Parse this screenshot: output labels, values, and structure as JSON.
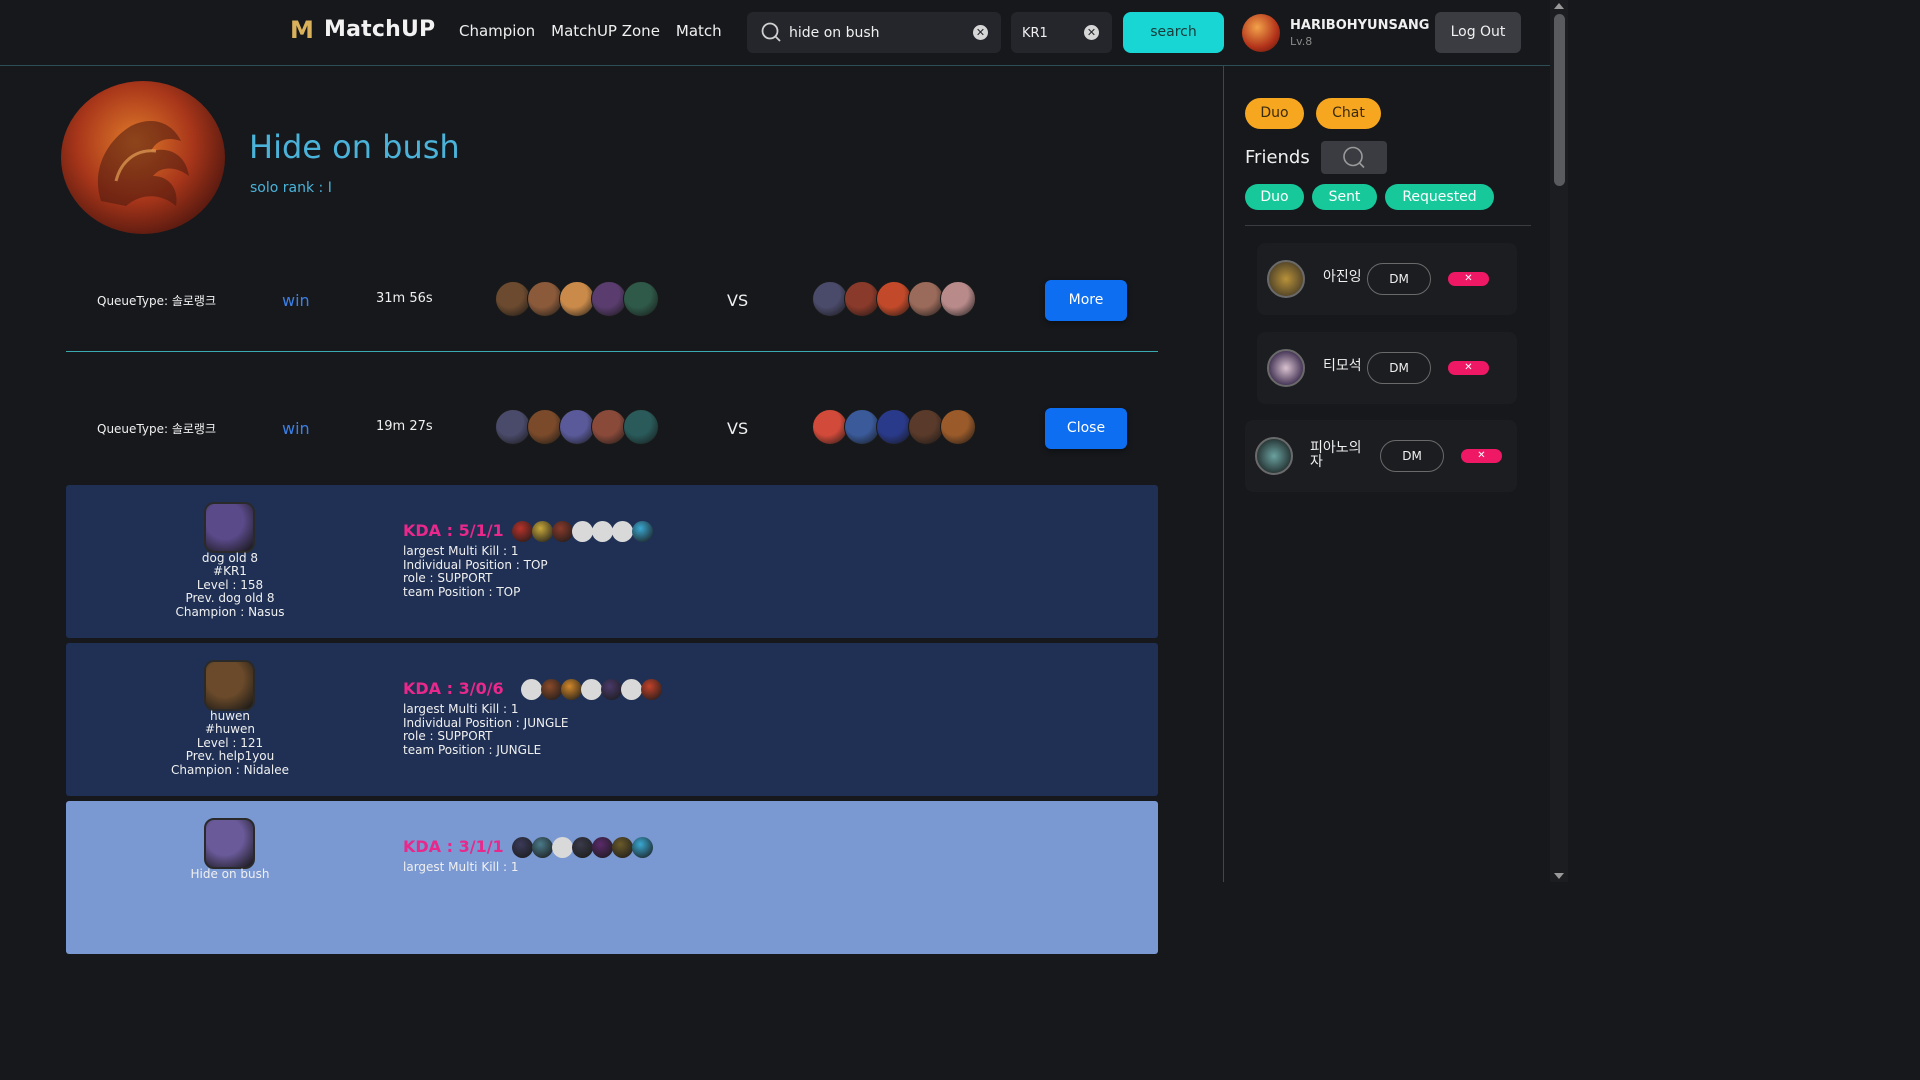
{
  "header": {
    "logo_mark": "M",
    "logo_text": "MatchUP",
    "nav": [
      "Champion",
      "MatchUP Zone",
      "Match"
    ],
    "search_value": "hide on bush",
    "region_value": "KR1",
    "search_button": "search",
    "user_name": "HARIBOHYUNSANG",
    "user_level": "Lv.8",
    "logout": "Log Out"
  },
  "profile": {
    "name": "Hide on bush",
    "solo_rank": "solo rank : I"
  },
  "matches": [
    {
      "queue": "QueueType: 솔로랭크",
      "result": "win",
      "duration": "31m 56s",
      "vs": "VS",
      "button": "More",
      "team1_colors": [
        "#6b4a2f",
        "#8a5a3a",
        "#c98a4a",
        "#5a3d6e",
        "#2f5a4a"
      ],
      "team2_colors": [
        "#4a4a6a",
        "#8a3a2a",
        "#c24a2a",
        "#9a6a5a",
        "#b88a8a"
      ]
    },
    {
      "queue": "QueueType: 솔로랭크",
      "result": "win",
      "duration": "19m 27s",
      "vs": "VS",
      "button": "Close",
      "team1_colors": [
        "#4a4a6a",
        "#7a4a2a",
        "#5a5a9a",
        "#8a4a3a",
        "#2a5a5a"
      ],
      "team2_colors": [
        "#d24a3a",
        "#3a5a9a",
        "#2a3a8a",
        "#5a3a2a",
        "#9a5a2a"
      ]
    }
  ],
  "players": [
    {
      "name": "dog old 8",
      "tag": "#KR1",
      "level": "Level : 158",
      "prev": "Prev. dog old 8",
      "champion": "Champion : Nasus",
      "kda": "KDA : 5/1/1",
      "multi_kill": "largest Multi Kill : 1",
      "individual_position": "Individual Position : TOP",
      "role": "role : SUPPORT",
      "team_position": "team Position : TOP",
      "avatar_color": "#5a4a8a",
      "items": [
        "#b8322a",
        "#c8a83a",
        "#8a3a2a",
        "empty",
        "empty",
        "empty",
        "#3aa8d2"
      ]
    },
    {
      "name": "huwen",
      "tag": "#huwen",
      "level": "Level : 121",
      "prev": "Prev. help1you",
      "champion": "Champion : Nidalee",
      "kda": "KDA : 3/0/6",
      "multi_kill": "largest Multi Kill : 1",
      "individual_position": "Individual Position : JUNGLE",
      "role": "role : SUPPORT",
      "team_position": "team Position : JUNGLE",
      "avatar_color": "#6a4a2a",
      "items": [
        "empty",
        "#8a4a2a",
        "#d2882a",
        "empty",
        "#4a3a6a",
        "empty",
        "#c2422a"
      ]
    },
    {
      "name": "Hide on bush",
      "kda": "KDA : 3/1/1",
      "multi_kill": "largest Multi Kill : 1",
      "avatar_color": "#6a5a9a",
      "items": [
        "#3a3a5a",
        "#4a7a8a",
        "empty",
        "#3a3a4a",
        "#5a2a6a",
        "#6a5a2a",
        "#3aa8d2"
      ]
    }
  ],
  "sidebar": {
    "tabs": [
      "Duo",
      "Chat"
    ],
    "friends_title": "Friends",
    "filters": [
      "Duo",
      "Sent",
      "Requested"
    ],
    "friends": [
      {
        "name": "아진잉",
        "dm": "DM",
        "remove": "✕"
      },
      {
        "name": "티모석",
        "dm": "DM",
        "remove": "✕"
      },
      {
        "name": "피아노의\n자",
        "dm": "DM",
        "remove": "✕"
      }
    ]
  },
  "colors": {
    "accent_cyan": "#17d6d3",
    "link_blue": "#4bb3d9",
    "button_blue": "#0d6ef2",
    "kda_pink": "#e8288a",
    "orange": "#f6a61f",
    "green": "#17c99a",
    "delete_pink": "#ee1864"
  }
}
